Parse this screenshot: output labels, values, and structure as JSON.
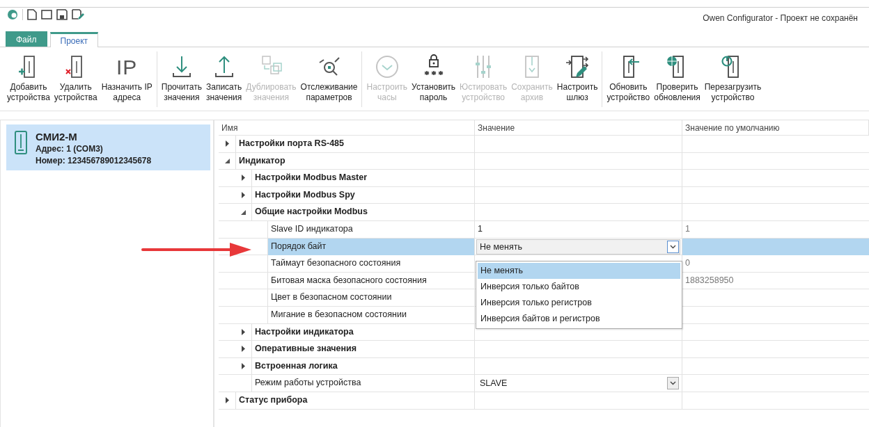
{
  "window": {
    "title": "Owen Configurator - Проект не сохранён"
  },
  "tabs": [
    {
      "label": "Файл",
      "selected": false,
      "kind": "file"
    },
    {
      "label": "Проект",
      "selected": true,
      "kind": "page"
    }
  ],
  "ribbon": [
    {
      "buttons": [
        {
          "lines": [
            "Добавить",
            "устройства"
          ],
          "disabled": false
        },
        {
          "lines": [
            "Удалить",
            "устройства"
          ],
          "disabled": false
        },
        {
          "lines": [
            "Назначить IP",
            "адреса"
          ],
          "disabled": false,
          "icon_text": "IP"
        }
      ]
    },
    {
      "buttons": [
        {
          "lines": [
            "Прочитать",
            "значения"
          ],
          "disabled": false
        },
        {
          "lines": [
            "Записать",
            "значения"
          ],
          "disabled": false
        },
        {
          "lines": [
            "Дублировать",
            "значения"
          ],
          "disabled": true
        },
        {
          "lines": [
            "Отслеживание",
            "параметров"
          ],
          "disabled": false
        }
      ]
    },
    {
      "buttons": [
        {
          "lines": [
            "Настроить",
            "часы"
          ],
          "disabled": true
        },
        {
          "lines": [
            "Установить",
            "пароль"
          ],
          "disabled": false
        },
        {
          "lines": [
            "Юстировать",
            "устройство"
          ],
          "disabled": true
        },
        {
          "lines": [
            "Сохранить",
            "архив"
          ],
          "disabled": true
        },
        {
          "lines": [
            "Настроить",
            "шлюз"
          ],
          "disabled": false
        }
      ]
    },
    {
      "buttons": [
        {
          "lines": [
            "Обновить",
            "устройство"
          ],
          "disabled": false
        },
        {
          "lines": [
            "Проверить",
            "обновления"
          ],
          "disabled": false
        },
        {
          "lines": [
            "Перезагрузить",
            "устройство"
          ],
          "disabled": false
        }
      ]
    }
  ],
  "device": {
    "name": "СМИ2-М",
    "address": "Адрес: 1 (COM3)",
    "number": "Номер: 123456789012345678",
    "selected": true
  },
  "grid": {
    "columns": [
      "Имя",
      "Значение",
      "Значение по умолчанию"
    ],
    "rows": [
      {
        "kind": "group",
        "name": "Настройки порта RS-485",
        "expanded": false,
        "selected": false
      },
      {
        "kind": "group",
        "name": "Индикатор",
        "expanded": true,
        "selected": false,
        "children": [
          {
            "kind": "group",
            "name": "Настройки Modbus Master",
            "expanded": false,
            "selected": false
          },
          {
            "kind": "group",
            "name": "Настройки Modbus Spy",
            "expanded": false,
            "selected": false
          },
          {
            "kind": "group",
            "name": "Общие настройки Modbus",
            "expanded": true,
            "selected": false,
            "children": [
              {
                "kind": "value",
                "name": "Slave ID индикатора",
                "value": "1",
                "default": "1",
                "selected": false
              },
              {
                "kind": "combo",
                "name": "Порядок байт",
                "value": "Не менять",
                "selected": true,
                "open": true,
                "options": [
                  {
                    "label": "Не менять",
                    "selected": true
                  },
                  {
                    "label": "Инверсия только байтов",
                    "selected": false
                  },
                  {
                    "label": "Инверсия только регистров",
                    "selected": false
                  },
                  {
                    "label": "Инверсия байтов и регистров",
                    "selected": false
                  }
                ]
              },
              {
                "kind": "value",
                "name": "Таймаут безопасного состояния",
                "default": "0",
                "selected": false
              },
              {
                "kind": "value",
                "name": "Битовая маска безопасного состояния",
                "default": "1883258950",
                "selected": false
              },
              {
                "kind": "value",
                "name": "Цвет в безопасном состоянии",
                "selected": false
              },
              {
                "kind": "value",
                "name": "Мигание в безопасном состоянии",
                "selected": false
              }
            ]
          },
          {
            "kind": "group",
            "name": "Настройки индикатора",
            "expanded": false,
            "selected": false
          },
          {
            "kind": "group",
            "name": "Оперативные значения",
            "expanded": false,
            "selected": false
          },
          {
            "kind": "group",
            "name": "Встроенная логика",
            "expanded": false,
            "selected": false
          },
          {
            "kind": "combo",
            "name": "Режим работы устройства",
            "value": "SLAVE",
            "selected": false,
            "open": false
          }
        ]
      },
      {
        "kind": "group",
        "name": "Статус прибора",
        "expanded": false,
        "selected": false
      }
    ]
  }
}
